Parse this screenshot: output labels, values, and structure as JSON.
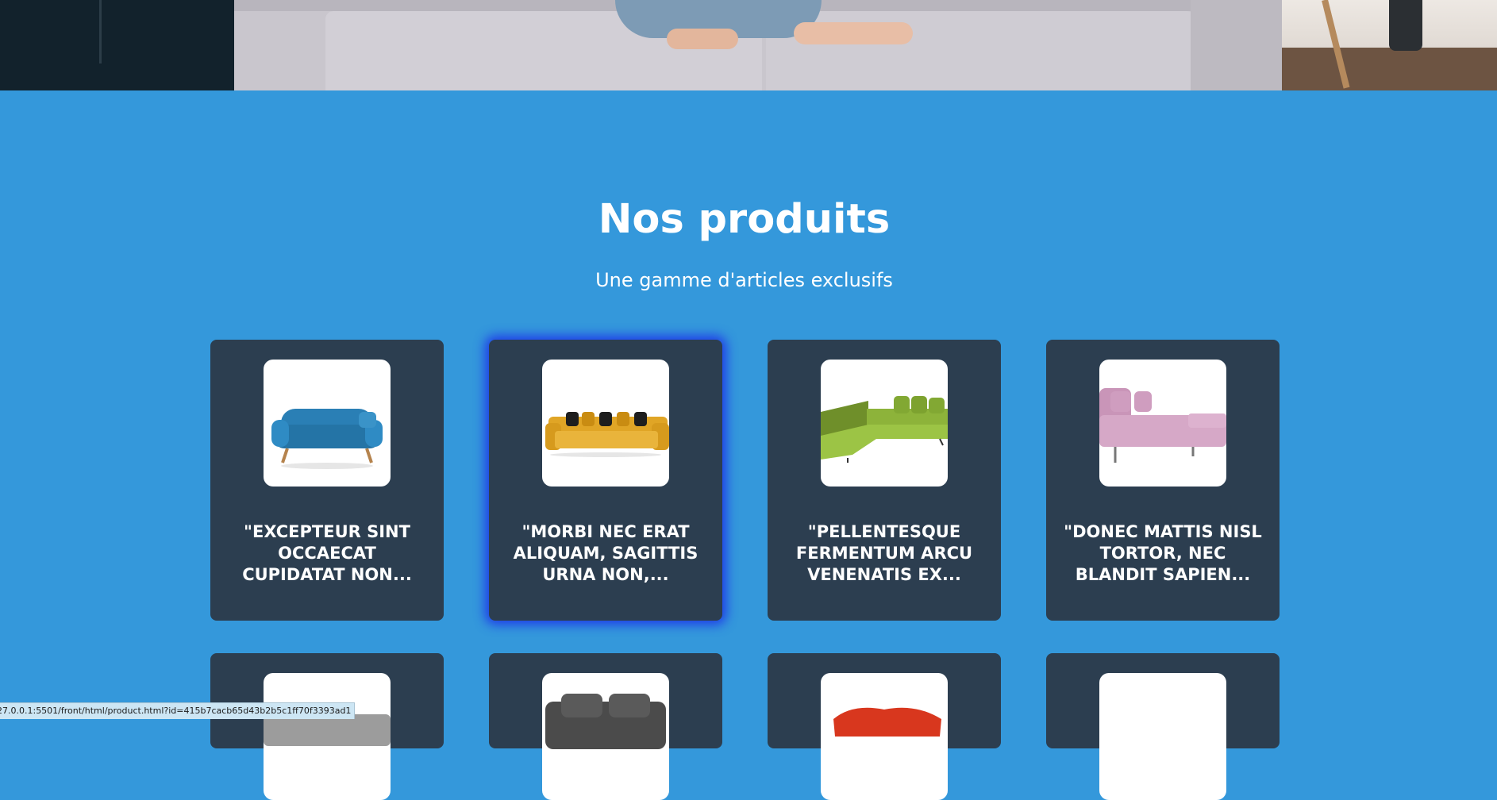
{
  "section": {
    "title": "Nos produits",
    "subtitle": "Une gamme d'articles exclusifs"
  },
  "products": [
    {
      "name": "\"EXCEPTEUR SINT OCCAECAT CUPIDATAT NON...",
      "image_icon": "blue-sofa-icon",
      "colors": {
        "main": "#2a7fb5"
      }
    },
    {
      "name": "\"MORBI NEC ERAT ALIQUAM, SAGITTIS URNA NON,...",
      "image_icon": "yellow-sofa-icon",
      "colors": {
        "main": "#e0a526"
      }
    },
    {
      "name": "\"PELLENTESQUE FERMENTUM ARCU VENENATIS EX...",
      "image_icon": "green-sectional-sofa-icon",
      "colors": {
        "main": "#8db33a"
      }
    },
    {
      "name": "\"DONEC MATTIS NISL TORTOR, NEC BLANDIT SAPIEN...",
      "image_icon": "pink-chaise-sofa-icon",
      "colors": {
        "main": "#d6a8c7"
      }
    },
    {
      "name": "",
      "image_icon": "grey-sofa-icon",
      "colors": {
        "main": "#5e5e5e"
      }
    },
    {
      "name": "",
      "image_icon": "dark-grey-sofa-icon",
      "colors": {
        "main": "#4b4b4b"
      }
    },
    {
      "name": "",
      "image_icon": "red-sofa-icon",
      "colors": {
        "main": "#d8371e"
      }
    },
    {
      "name": "",
      "image_icon": "product-image-icon",
      "colors": {
        "main": "#ffffff"
      }
    }
  ],
  "status_bar": {
    "url": "27.0.0.1:5501/front/html/product.html?id=415b7cacb65d43b2b5c1ff70f3393ad1"
  },
  "colors": {
    "page_background": "#3498db",
    "card_background": "#2c3e50",
    "focus_glow": "#1f3be8"
  }
}
